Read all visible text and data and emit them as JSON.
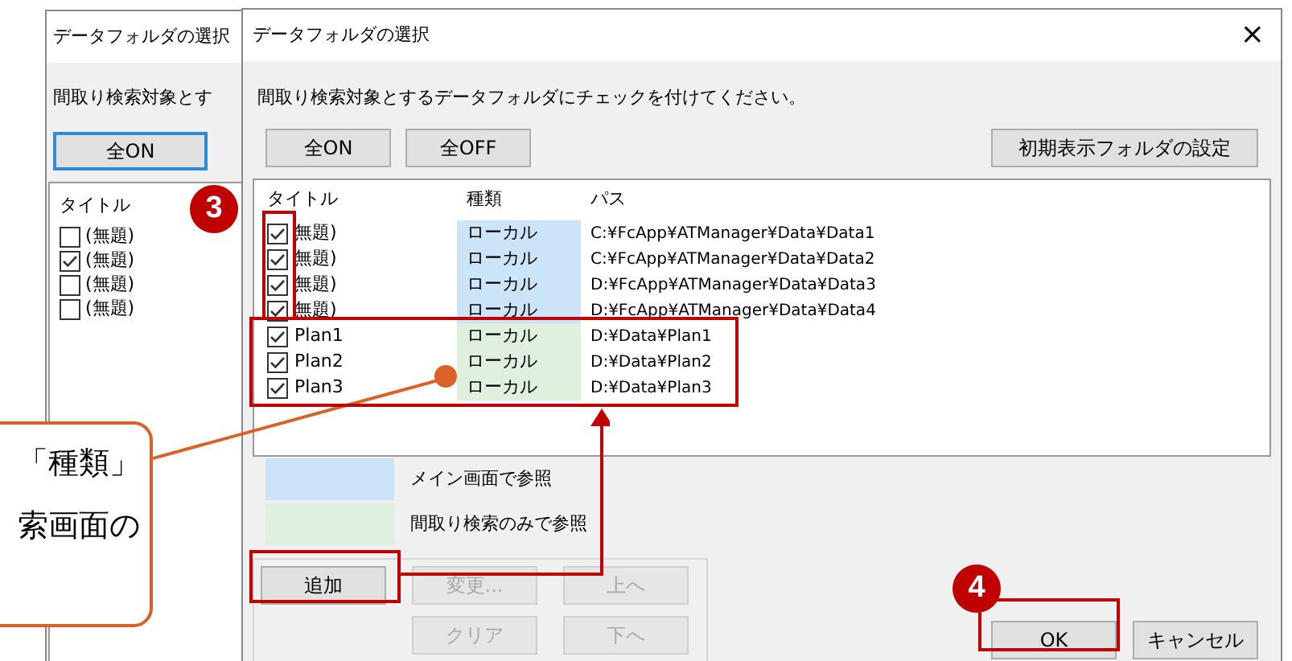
{
  "back_dialog": {
    "title": "データフォルダの選択",
    "instruction": "間取り検索対象とす",
    "button": "全ON",
    "list_header": "タイトル",
    "items": [
      {
        "label": "(無題)",
        "checked": false
      },
      {
        "label": "(無題)",
        "checked": true
      },
      {
        "label": "(無題)",
        "checked": false
      },
      {
        "label": "(無題)",
        "checked": false
      }
    ]
  },
  "callout": {
    "lines": [
      "「種類」",
      "索画面の"
    ]
  },
  "dialog": {
    "title": "データフォルダの選択",
    "close": "×",
    "instruction": "間取り検索対象とするデータフォルダにチェックを付けてください。",
    "top_buttons": [
      "全ON",
      "全OFF"
    ],
    "settings_button": "初期表示フォルダの設定",
    "columns": [
      "タイトル",
      "種類",
      "パス"
    ],
    "rows": [
      {
        "title": "無題)",
        "checked": true,
        "type": "ローカル",
        "path": "C:¥FcApp¥ATManager¥Data¥Data1",
        "color": "#cce4f7"
      },
      {
        "title": "無題)",
        "checked": true,
        "type": "ローカル",
        "path": "C:¥FcApp¥ATManager¥Data¥Data2",
        "color": "#cce4f7"
      },
      {
        "title": "無題)",
        "checked": true,
        "type": "ローカル",
        "path": "D:¥FcApp¥ATManager¥Data¥Data3",
        "color": "#cce4f7"
      },
      {
        "title": "無題)",
        "checked": true,
        "type": "ローカル",
        "path": "D:¥FcApp¥ATManager¥Data¥Data4",
        "color": "#cce4f7"
      },
      {
        "title": "Plan1",
        "checked": true,
        "type": "ローカル",
        "path": "D:¥Data¥Plan1",
        "color": "#dff0df"
      },
      {
        "title": "Plan2",
        "checked": true,
        "type": "ローカル",
        "path": "D:¥Data¥Plan2",
        "color": "#dff0df"
      },
      {
        "title": "Plan3",
        "checked": true,
        "type": "ローカル",
        "path": "D:¥Data¥Plan3",
        "color": "#dff0df"
      }
    ],
    "legend": [
      {
        "label": "メイン画面で参照",
        "color": "#cce4f7"
      },
      {
        "label": "間取り検索のみで参照",
        "color": "#dff0df"
      }
    ],
    "edit_buttons": [
      {
        "label": "追加",
        "disabled": false
      },
      {
        "label": "変更...",
        "disabled": true
      },
      {
        "label": "上へ",
        "disabled": true
      },
      {
        "label": "クリア",
        "disabled": true
      },
      {
        "label": "下へ",
        "disabled": true
      }
    ],
    "ok": "OK",
    "cancel": "キャンセル"
  },
  "steps": [
    "3",
    "4"
  ]
}
